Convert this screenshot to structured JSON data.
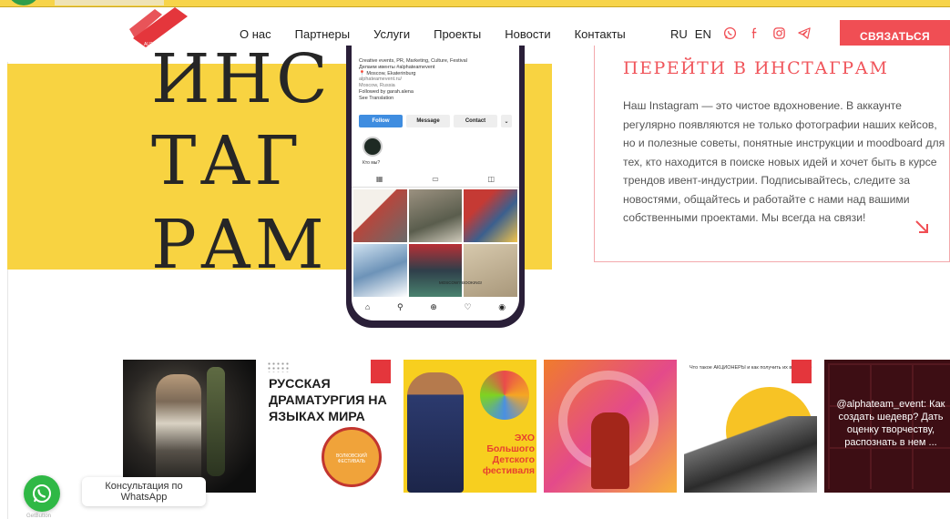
{
  "header": {
    "nav": [
      "О нас",
      "Партнеры",
      "Услуги",
      "Проекты",
      "Новости",
      "Контакты"
    ],
    "lang": [
      "RU",
      "EN"
    ],
    "social_icons": [
      "whatsapp-icon",
      "facebook-icon",
      "instagram-icon",
      "telegram-icon"
    ],
    "contact_button": "СВЯЗАТЬСЯ",
    "logo_text": "ALPHA TEAM"
  },
  "hero": {
    "big_word_lines": [
      "ИНС",
      "ТАГ",
      "РАМ"
    ]
  },
  "phone": {
    "bio_lines": [
      "Creative events, PR, Marketing, Culture, Festival",
      "Делаем ивенты #alphateamevent",
      "📍 Moscow, Ekaterinburg",
      "alphateamevent.ru/",
      "Moscow, Russia",
      "Followed by garah.alena",
      "See Translation"
    ],
    "buttons": [
      "Follow",
      "Message",
      "Contact",
      "⌄"
    ],
    "story_label": "Кто мы?",
    "post_caption": "MOSCOW? BOOKING!",
    "tabs": [
      "▦",
      "▭",
      "◫"
    ],
    "bottom_nav": [
      "⌂",
      "⚲",
      "⊕",
      "♡",
      "◉"
    ]
  },
  "ig_card": {
    "title": "ПЕРЕЙТИ В ИНСТАГРАМ",
    "text": "Наш Instagram — это чистое вдохновение. В аккаунте регулярно появляются не только фотографии наших кейсов, но и полезные советы, понятные инструкции и moodboard для тех, кто находится в поиске новых идей и хочет быть в курсе трендов ивент-индустрии. Подписывайтесь, следите за новостями, общайтесь и работайте с нами над вашими собственными проектами. Мы всегда на связи!"
  },
  "gallery": {
    "tile2_text": "РУССКАЯ ДРАМАТУРГИЯ НА ЯЗЫКАХ МИРА",
    "tile2_badge": "ВОЛКОВСКИЙ ФЕСТИВАЛЬ",
    "tile3_text": "ЭХО Большого Детского фестиваля",
    "tile5_head": "Что такое АКЦИОНЕРЫ и как получить их внимание",
    "tile6_caption": "@alphateam_event: Как создать шедевр? Дать оценку творчеству, распознать в нем ..."
  },
  "whatsapp": {
    "tooltip": "Консультация по WhatsApp",
    "footer": "GetButton"
  },
  "colors": {
    "accent": "#f04e54",
    "yellow": "#f8d341",
    "whatsapp": "#2fb845"
  }
}
